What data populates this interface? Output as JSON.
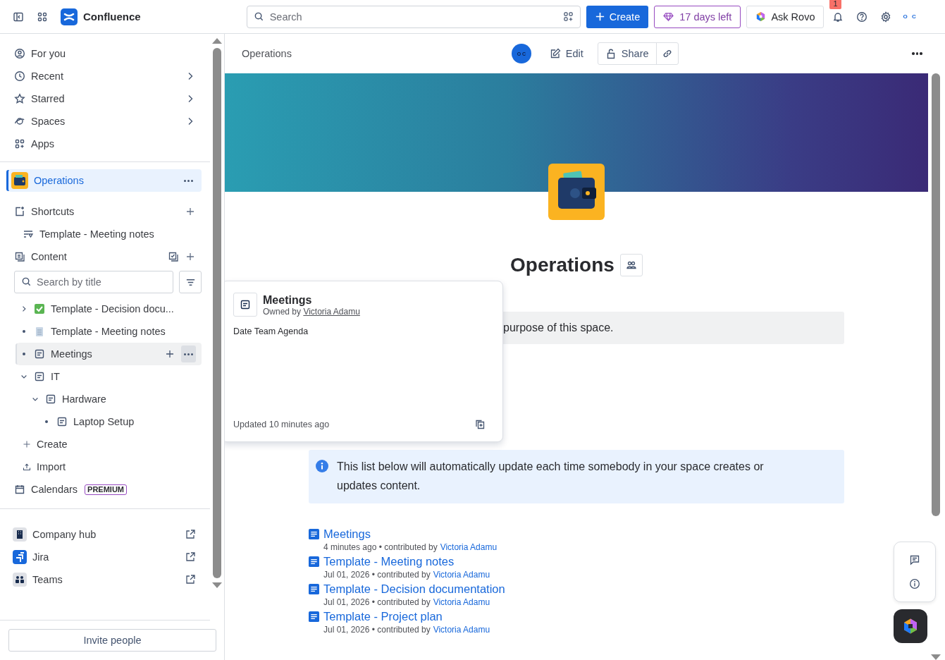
{
  "topbar": {
    "product": "Confluence",
    "search": {
      "placeholder": "Search"
    },
    "create": "Create",
    "trial": "17 days left",
    "ask": "Ask Rovo",
    "notifications": "1",
    "avatar": "O C"
  },
  "sidebar": {
    "nav": [
      {
        "label": "For you",
        "submenu": false
      },
      {
        "label": "Recent",
        "submenu": true
      },
      {
        "label": "Starred",
        "submenu": true
      },
      {
        "label": "Spaces",
        "submenu": true
      },
      {
        "label": "Apps",
        "submenu": false
      }
    ],
    "space": {
      "name": "Operations",
      "selected": true
    },
    "shortcuts": {
      "label": "Shortcuts",
      "items": [
        "Template - Meeting notes"
      ]
    },
    "content": {
      "label": "Content",
      "search": {
        "placeholder": "Search by title"
      },
      "tree": [
        {
          "title": "Template - Decision docu...",
          "kind": "decision",
          "expanded": false,
          "selected": false
        },
        {
          "title": "Template - Meeting notes",
          "kind": "notes",
          "selected": false
        },
        {
          "title": "Meetings",
          "kind": "page",
          "selected": true
        },
        {
          "title": "IT",
          "kind": "page",
          "expanded": true,
          "selected": false,
          "children": [
            {
              "title": "Hardware",
              "kind": "page",
              "expanded": true,
              "selected": false,
              "children": [
                {
                  "title": "Laptop Setup",
                  "kind": "page",
                  "selected": false
                }
              ]
            }
          ]
        }
      ],
      "create": "Create",
      "import": "Import"
    },
    "calendars": {
      "label": "Calendars",
      "badge": "PREMIUM"
    },
    "apps": [
      "Company hub",
      "Jira",
      "Teams"
    ],
    "invite": "Invite people"
  },
  "page": {
    "breadcrumb": "Operations",
    "avatar": "O C",
    "edit": "Edit",
    "share": "Share",
    "title": "Operations",
    "purpose": "purpose of this space.",
    "info": "This list below will automatically update each time somebody in your space creates or updates content.",
    "recent": [
      {
        "title": "Meetings",
        "meta": "4 minutes ago • contributed by",
        "author": "Victoria Adamu"
      },
      {
        "title": "Template - Meeting notes",
        "meta": "Jul 01, 2026 • contributed by",
        "author": "Victoria Adamu"
      },
      {
        "title": "Template - Decision documentation",
        "meta": "Jul 01, 2026 • contributed by",
        "author": "Victoria Adamu"
      },
      {
        "title": "Template - Project plan",
        "meta": "Jul 01, 2026 • contributed by",
        "author": "Victoria Adamu"
      }
    ]
  },
  "hover_card": {
    "title": "Meetings",
    "owner_prefix": "Owned by",
    "owner": "Victoria Adamu",
    "excerpt": "Date Team Agenda",
    "updated": "Updated 10 minutes ago"
  }
}
